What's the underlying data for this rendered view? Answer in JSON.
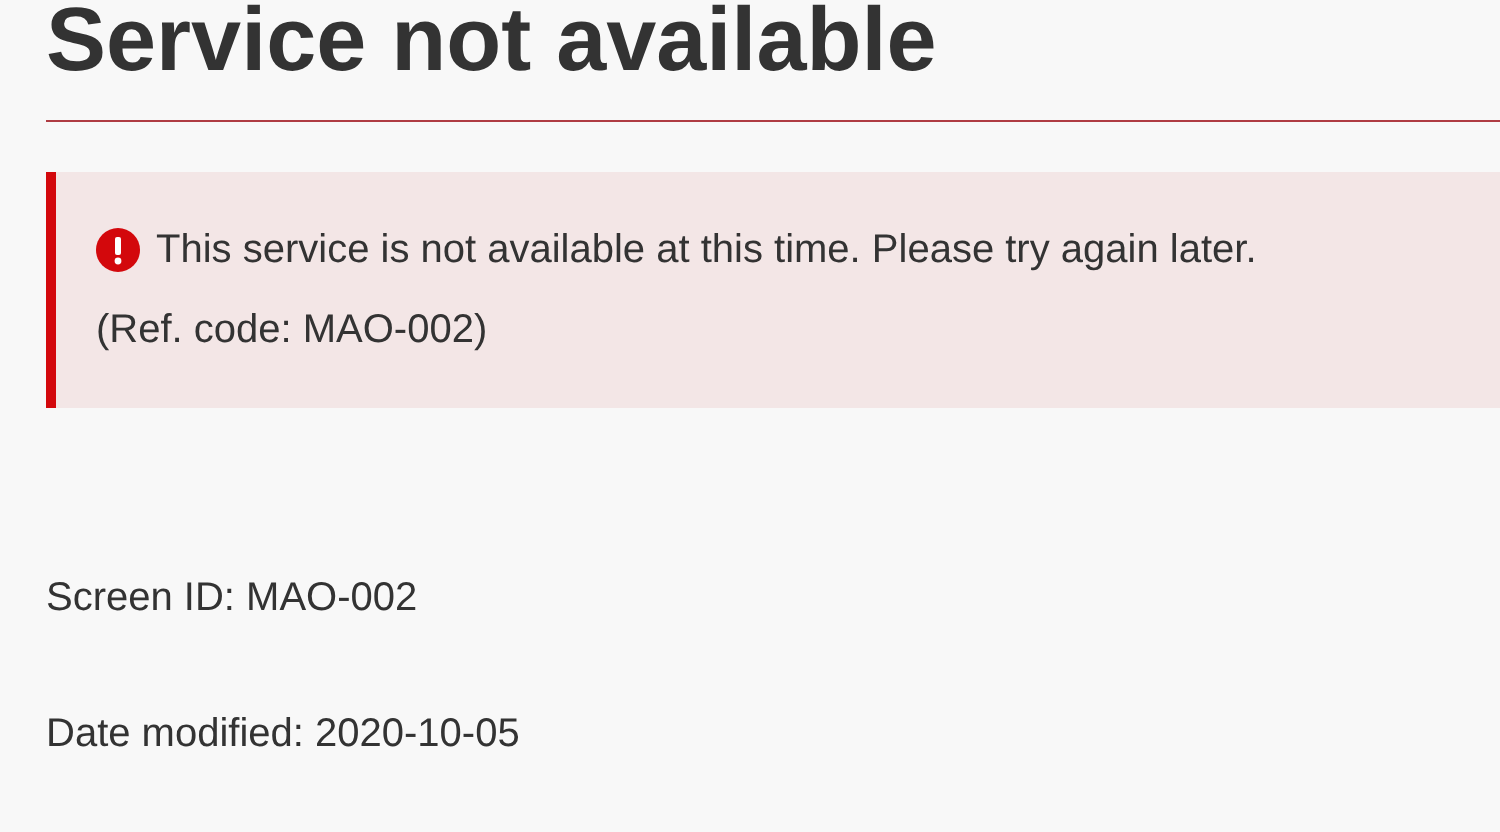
{
  "heading": "Service not available",
  "alert": {
    "kind": "error",
    "message": "This service is not available at this time. Please try again later.",
    "reference": "(Ref. code: MAO-002)"
  },
  "details": [
    {
      "label": "Screen ID: MAO-002"
    },
    {
      "label": "Date modified: 2020-10-05"
    }
  ]
}
